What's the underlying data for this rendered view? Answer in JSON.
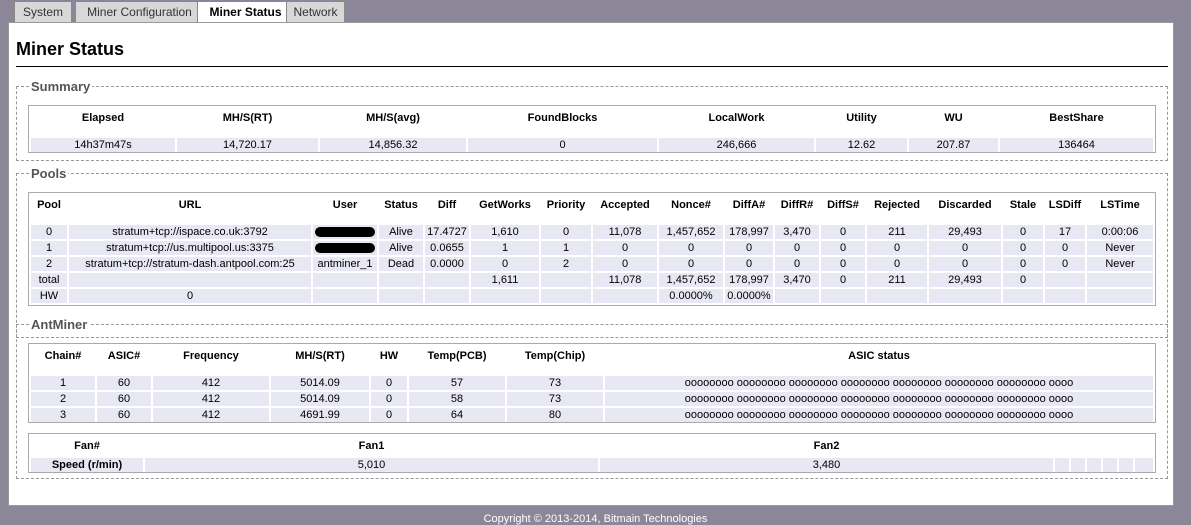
{
  "tabs": [
    "System",
    "Miner Configuration",
    "Miner Status",
    "Network"
  ],
  "page_title": "Miner Status",
  "summary": {
    "legend": "Summary",
    "headers": [
      "Elapsed",
      "MH/S(RT)",
      "MH/S(avg)",
      "FoundBlocks",
      "LocalWork",
      "Utility",
      "WU",
      "BestShare"
    ],
    "values": [
      "14h37m47s",
      "14,720.17",
      "14,856.32",
      "0",
      "246,666",
      "12.62",
      "207.87",
      "136464"
    ]
  },
  "pools": {
    "legend": "Pools",
    "headers": [
      "Pool",
      "URL",
      "User",
      "Status",
      "Diff",
      "GetWorks",
      "Priority",
      "Accepted",
      "Nonce#",
      "DiffA#",
      "DiffR#",
      "DiffS#",
      "Rejected",
      "Discarded",
      "Stale",
      "LSDiff",
      "LSTime"
    ],
    "rows": [
      [
        "0",
        "stratum+tcp://ispace.co.uk:3792",
        "",
        "Alive",
        "17.4727",
        "1,610",
        "0",
        "11,078",
        "1,457,652",
        "178,997",
        "3,470",
        "0",
        "211",
        "29,493",
        "0",
        "17",
        "0:00:06"
      ],
      [
        "1",
        "stratum+tcp://us.multipool.us:3375",
        "",
        "Alive",
        "0.0655",
        "1",
        "1",
        "0",
        "0",
        "0",
        "0",
        "0",
        "0",
        "0",
        "0",
        "0",
        "Never"
      ],
      [
        "2",
        "stratum+tcp://stratum-dash.antpool.com:25",
        "antminer_1",
        "Dead",
        "0.0000",
        "0",
        "2",
        "0",
        "0",
        "0",
        "0",
        "0",
        "0",
        "0",
        "0",
        "0",
        "Never"
      ],
      [
        "total",
        "",
        "",
        "",
        "",
        "1,611",
        "",
        "11,078",
        "1,457,652",
        "178,997",
        "3,470",
        "0",
        "211",
        "29,493",
        "0",
        "",
        ""
      ],
      [
        "HW",
        "0",
        "",
        "",
        "",
        "",
        "",
        "",
        "0.0000%",
        "0.0000%",
        "",
        "",
        "",
        "",
        "",
        "",
        ""
      ]
    ]
  },
  "antminer": {
    "legend": "AntMiner",
    "headers": [
      "Chain#",
      "ASIC#",
      "Frequency",
      "MH/S(RT)",
      "HW",
      "Temp(PCB)",
      "Temp(Chip)",
      "ASIC status"
    ],
    "rows": [
      [
        "1",
        "60",
        "412",
        "5014.09",
        "0",
        "57",
        "73",
        "oooooooo oooooooo oooooooo oooooooo oooooooo oooooooo oooooooo oooo"
      ],
      [
        "2",
        "60",
        "412",
        "5014.09",
        "0",
        "58",
        "73",
        "oooooooo oooooooo oooooooo oooooooo oooooooo oooooooo oooooooo oooo"
      ],
      [
        "3",
        "60",
        "412",
        "4691.99",
        "0",
        "64",
        "80",
        "oooooooo oooooooo oooooooo oooooooo oooooooo oooooooo oooooooo oooo"
      ]
    ],
    "fan_headers": [
      "Fan#",
      "Fan1",
      "Fan2"
    ],
    "fan_row_label": "Speed (r/min)",
    "fan_values": [
      "5,010",
      "3,480"
    ]
  },
  "footer": "Copyright © 2013-2014, Bitmain Technologies"
}
